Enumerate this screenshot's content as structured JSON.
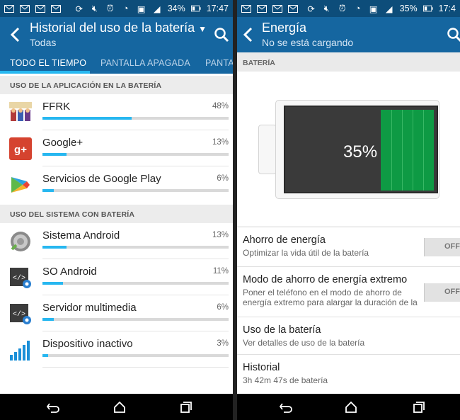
{
  "left": {
    "status": {
      "battery": "34%",
      "time": "17:47"
    },
    "title": "Historial del uso de la batería",
    "subtitle": "Todas",
    "tabs": [
      "TODO EL TIEMPO",
      "PANTALLA APAGADA",
      "PANTA"
    ],
    "section_app": "USO DE LA APLICACIÓN EN LA BATERÍA",
    "apps": [
      {
        "name": "FFRK",
        "percent": "48%",
        "fraction": 0.48,
        "icon": "ffrk-icon"
      },
      {
        "name": "Google+",
        "percent": "13%",
        "fraction": 0.13,
        "icon": "google-plus-icon"
      },
      {
        "name": "Servicios de Google Play",
        "percent": "6%",
        "fraction": 0.06,
        "icon": "google-play-services-icon"
      }
    ],
    "section_system": "USO DEL SISTEMA CON BATERÍA",
    "system": [
      {
        "name": "Sistema Android",
        "percent": "13%",
        "fraction": 0.13,
        "icon": "android-system-icon"
      },
      {
        "name": "SO Android",
        "percent": "11%",
        "fraction": 0.11,
        "icon": "android-os-icon"
      },
      {
        "name": "Servidor multimedia",
        "percent": "6%",
        "fraction": 0.06,
        "icon": "media-server-icon"
      },
      {
        "name": "Dispositivo inactivo",
        "percent": "3%",
        "fraction": 0.03,
        "icon": "signal-bars-icon"
      }
    ]
  },
  "right": {
    "status": {
      "battery": "35%",
      "time": "17:4"
    },
    "title": "Energía",
    "subtitle": "No se está cargando",
    "section": "BATERÍA",
    "battery_label": "35%",
    "battery_level": 0.35,
    "settings": [
      {
        "title": "Ahorro de energía",
        "desc": "Optimizar la vida útil de la batería",
        "toggle": "OFF"
      },
      {
        "title": "Modo de ahorro de energía extremo",
        "desc": "Poner el teléfono en el modo de ahorro de energía extremo para alargar la duración de la",
        "toggle": "OFF"
      },
      {
        "title": "Uso de la batería",
        "desc": "Ver detalles de uso de la batería"
      },
      {
        "title": "Historial",
        "desc": "3h 42m 47s de batería"
      }
    ]
  },
  "colors": {
    "status_bar": "#0d4d7a",
    "app_bar": "#1566a0",
    "accent": "#27b7f0",
    "battery_green": "#0e9a44"
  }
}
